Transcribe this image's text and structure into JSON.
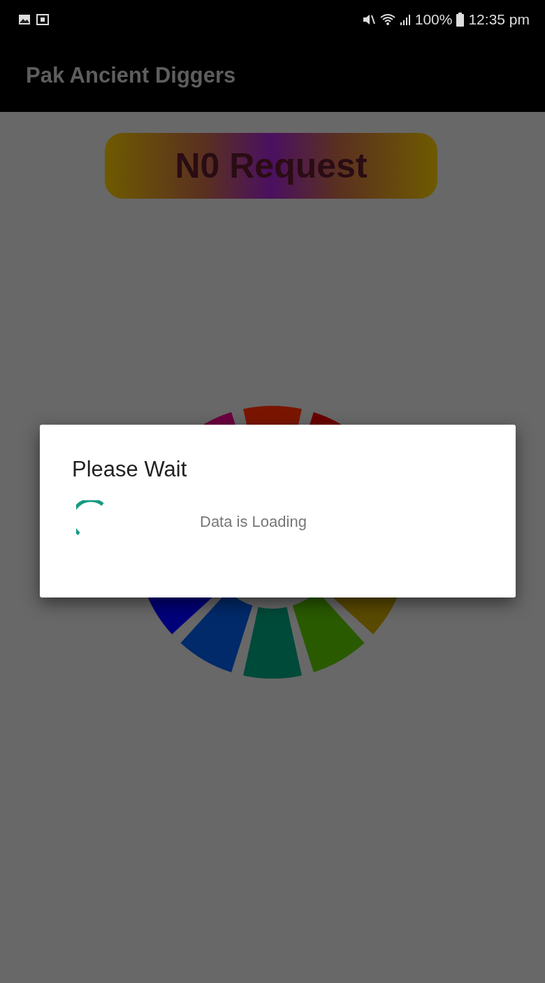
{
  "status_bar": {
    "battery": "100%",
    "time": "12:35 pm"
  },
  "app_bar": {
    "title": "Pak Ancient Diggers"
  },
  "request_button": {
    "label": "N0 Request"
  },
  "dialog": {
    "title": "Please Wait",
    "message": "Data is Loading"
  }
}
